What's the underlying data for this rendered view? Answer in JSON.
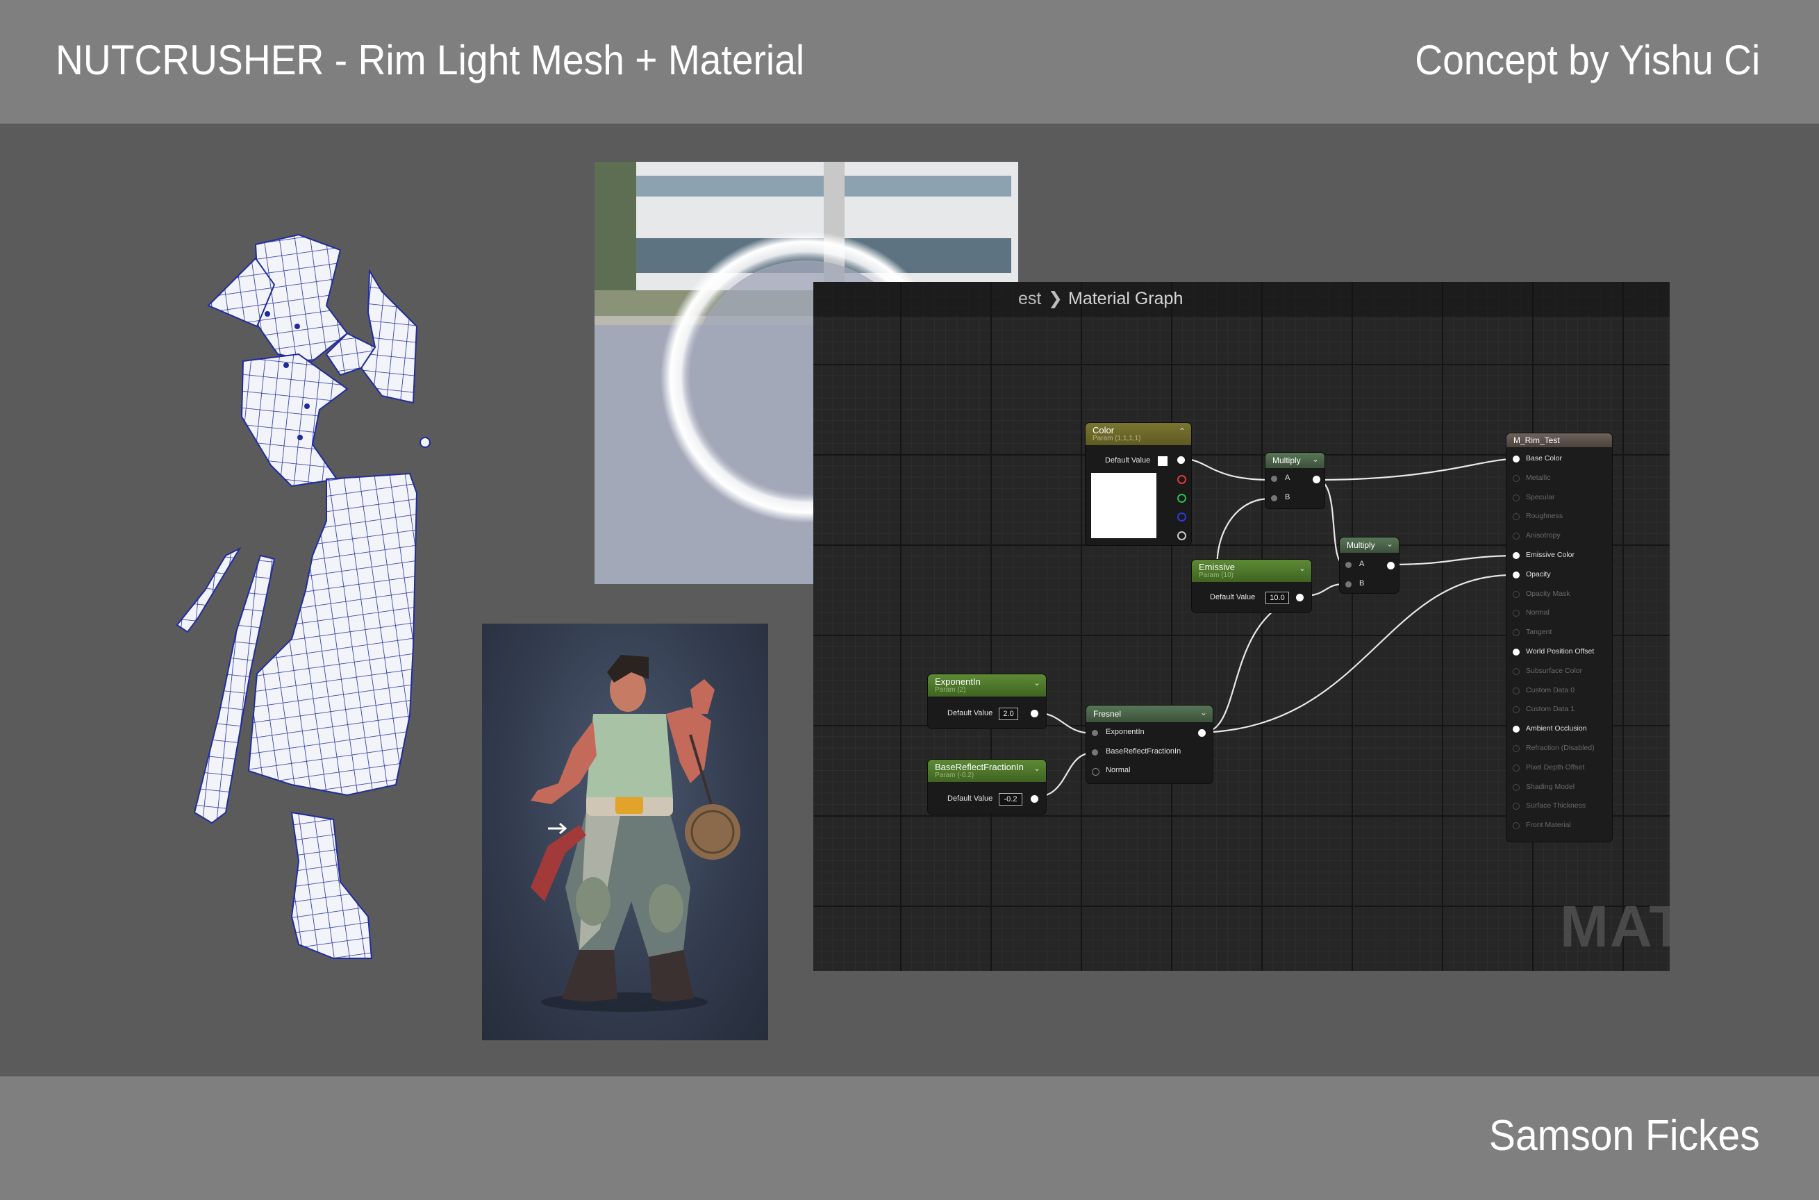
{
  "header": {
    "title": "NUTCRUSHER - Rim Light Mesh + Material",
    "concept_credit": "Concept by Yishu Ci"
  },
  "footer": {
    "author": "Samson Fickes"
  },
  "graph": {
    "breadcrumb_prev": "est",
    "breadcrumb_sep": "❯",
    "breadcrumb_current": "Material Graph",
    "watermark": "MAT",
    "nodes": {
      "color": {
        "title": "Color",
        "subtitle": "Param (1,1,1,1)",
        "default_label": "Default Value",
        "header_color": "#6e6a2a"
      },
      "emissive": {
        "title": "Emissive",
        "subtitle": "Param (10)",
        "default_label": "Default Value",
        "default_value": "10.0",
        "header_color": "#4e7a2c"
      },
      "exponentin": {
        "title": "ExponentIn",
        "subtitle": "Param (2)",
        "default_label": "Default Value",
        "default_value": "2.0",
        "header_color": "#4e7a2c"
      },
      "basereflect": {
        "title": "BaseReflectFractionIn",
        "subtitle": "Param (-0.2)",
        "default_label": "Default Value",
        "default_value": "-0.2",
        "header_color": "#4e7a2c"
      },
      "multiply1": {
        "title": "Multiply",
        "pins": [
          "A",
          "B"
        ]
      },
      "multiply2": {
        "title": "Multiply",
        "pins": [
          "A",
          "B"
        ]
      },
      "fresnel": {
        "title": "Fresnel",
        "pins": [
          "ExponentIn",
          "BaseReflectFractionIn",
          "Normal"
        ]
      },
      "result": {
        "title": "M_Rim_Test",
        "pins": [
          {
            "label": "Base Color",
            "active": true
          },
          {
            "label": "Metallic",
            "active": false
          },
          {
            "label": "Specular",
            "active": false
          },
          {
            "label": "Roughness",
            "active": false
          },
          {
            "label": "Anisotropy",
            "active": false
          },
          {
            "label": "Emissive Color",
            "active": true
          },
          {
            "label": "Opacity",
            "active": true
          },
          {
            "label": "Opacity Mask",
            "active": false
          },
          {
            "label": "Normal",
            "active": false
          },
          {
            "label": "Tangent",
            "active": false
          },
          {
            "label": "World Position Offset",
            "active": true
          },
          {
            "label": "Subsurface Color",
            "active": false
          },
          {
            "label": "Custom Data 0",
            "active": false
          },
          {
            "label": "Custom Data 1",
            "active": false
          },
          {
            "label": "Ambient Occlusion",
            "active": true
          },
          {
            "label": "Refraction (Disabled)",
            "active": false
          },
          {
            "label": "Pixel Depth Offset",
            "active": false
          },
          {
            "label": "Shading Model",
            "active": false
          },
          {
            "label": "Surface Thickness",
            "active": false
          },
          {
            "label": "Front Material",
            "active": false
          }
        ]
      }
    }
  }
}
